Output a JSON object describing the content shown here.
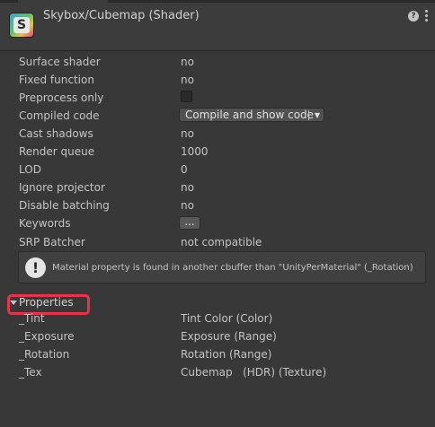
{
  "header": {
    "title": "Skybox/Cubemap (Shader)",
    "icon_letter": "S",
    "help_glyph": "?"
  },
  "rows": [
    {
      "label": "Surface shader",
      "value": "no"
    },
    {
      "label": "Fixed function",
      "value": "no"
    },
    {
      "label": "Preprocess only",
      "value": "",
      "checked": false
    },
    {
      "label": "Compiled code",
      "value": "Compile and show code"
    },
    {
      "label": "Cast shadows",
      "value": "no"
    },
    {
      "label": "Render queue",
      "value": "1000"
    },
    {
      "label": "LOD",
      "value": "0"
    },
    {
      "label": "Ignore projector",
      "value": "no"
    },
    {
      "label": "Disable batching",
      "value": "no"
    },
    {
      "label": "Keywords",
      "value": "..."
    },
    {
      "label": "SRP Batcher",
      "value": "not compatible"
    }
  ],
  "helpbox": {
    "icon": "!",
    "message": "Material property is found in another cbuffer than \"UnityPerMaterial\" (_Rotation)"
  },
  "properties": {
    "label": "Properties",
    "expanded": true,
    "items": [
      {
        "name": "_Tint",
        "value": "Tint Color (Color)"
      },
      {
        "name": "_Exposure",
        "value": "Exposure (Range)"
      },
      {
        "name": "_Rotation",
        "value": "Rotation (Range)"
      },
      {
        "name": "_Tex",
        "value": "Cubemap   (HDR) (Texture)"
      }
    ]
  },
  "colors": {
    "background": "#383838",
    "header": "#3c3c3c",
    "highlight": "#e8334a"
  }
}
